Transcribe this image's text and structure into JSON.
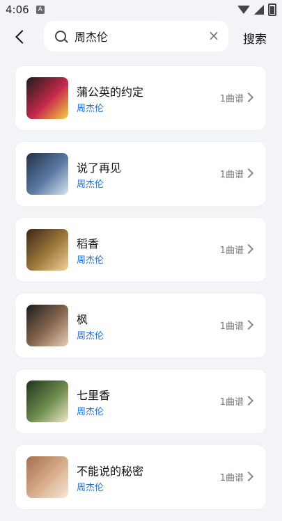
{
  "status": {
    "time": "4:06",
    "a_badge": "A"
  },
  "header": {
    "search_value": "周杰伦",
    "submit_label": "搜索"
  },
  "results": [
    {
      "title": "蒲公英的约定",
      "artist": "周杰伦",
      "count": "1曲谱",
      "cover_colors": [
        "#1d1d1d",
        "#c7284b",
        "#f2d13f"
      ]
    },
    {
      "title": "说了再见",
      "artist": "周杰伦",
      "count": "1曲谱",
      "cover_colors": [
        "#233043",
        "#5c7aa4",
        "#d6e4f2"
      ]
    },
    {
      "title": "稻香",
      "artist": "周杰伦",
      "count": "1曲谱",
      "cover_colors": [
        "#3a2617",
        "#a07a3d",
        "#f2d29a"
      ]
    },
    {
      "title": "枫",
      "artist": "周杰伦",
      "count": "1曲谱",
      "cover_colors": [
        "#1b1b1b",
        "#8b6a52",
        "#e7d0b8"
      ]
    },
    {
      "title": "七里香",
      "artist": "周杰伦",
      "count": "1曲谱",
      "cover_colors": [
        "#21331f",
        "#6e8d4e",
        "#f0e7c8"
      ]
    },
    {
      "title": "不能说的秘密",
      "artist": "周杰伦",
      "count": "1曲谱",
      "cover_colors": [
        "#a56e4c",
        "#d9b08e",
        "#f7e8d8"
      ]
    }
  ]
}
